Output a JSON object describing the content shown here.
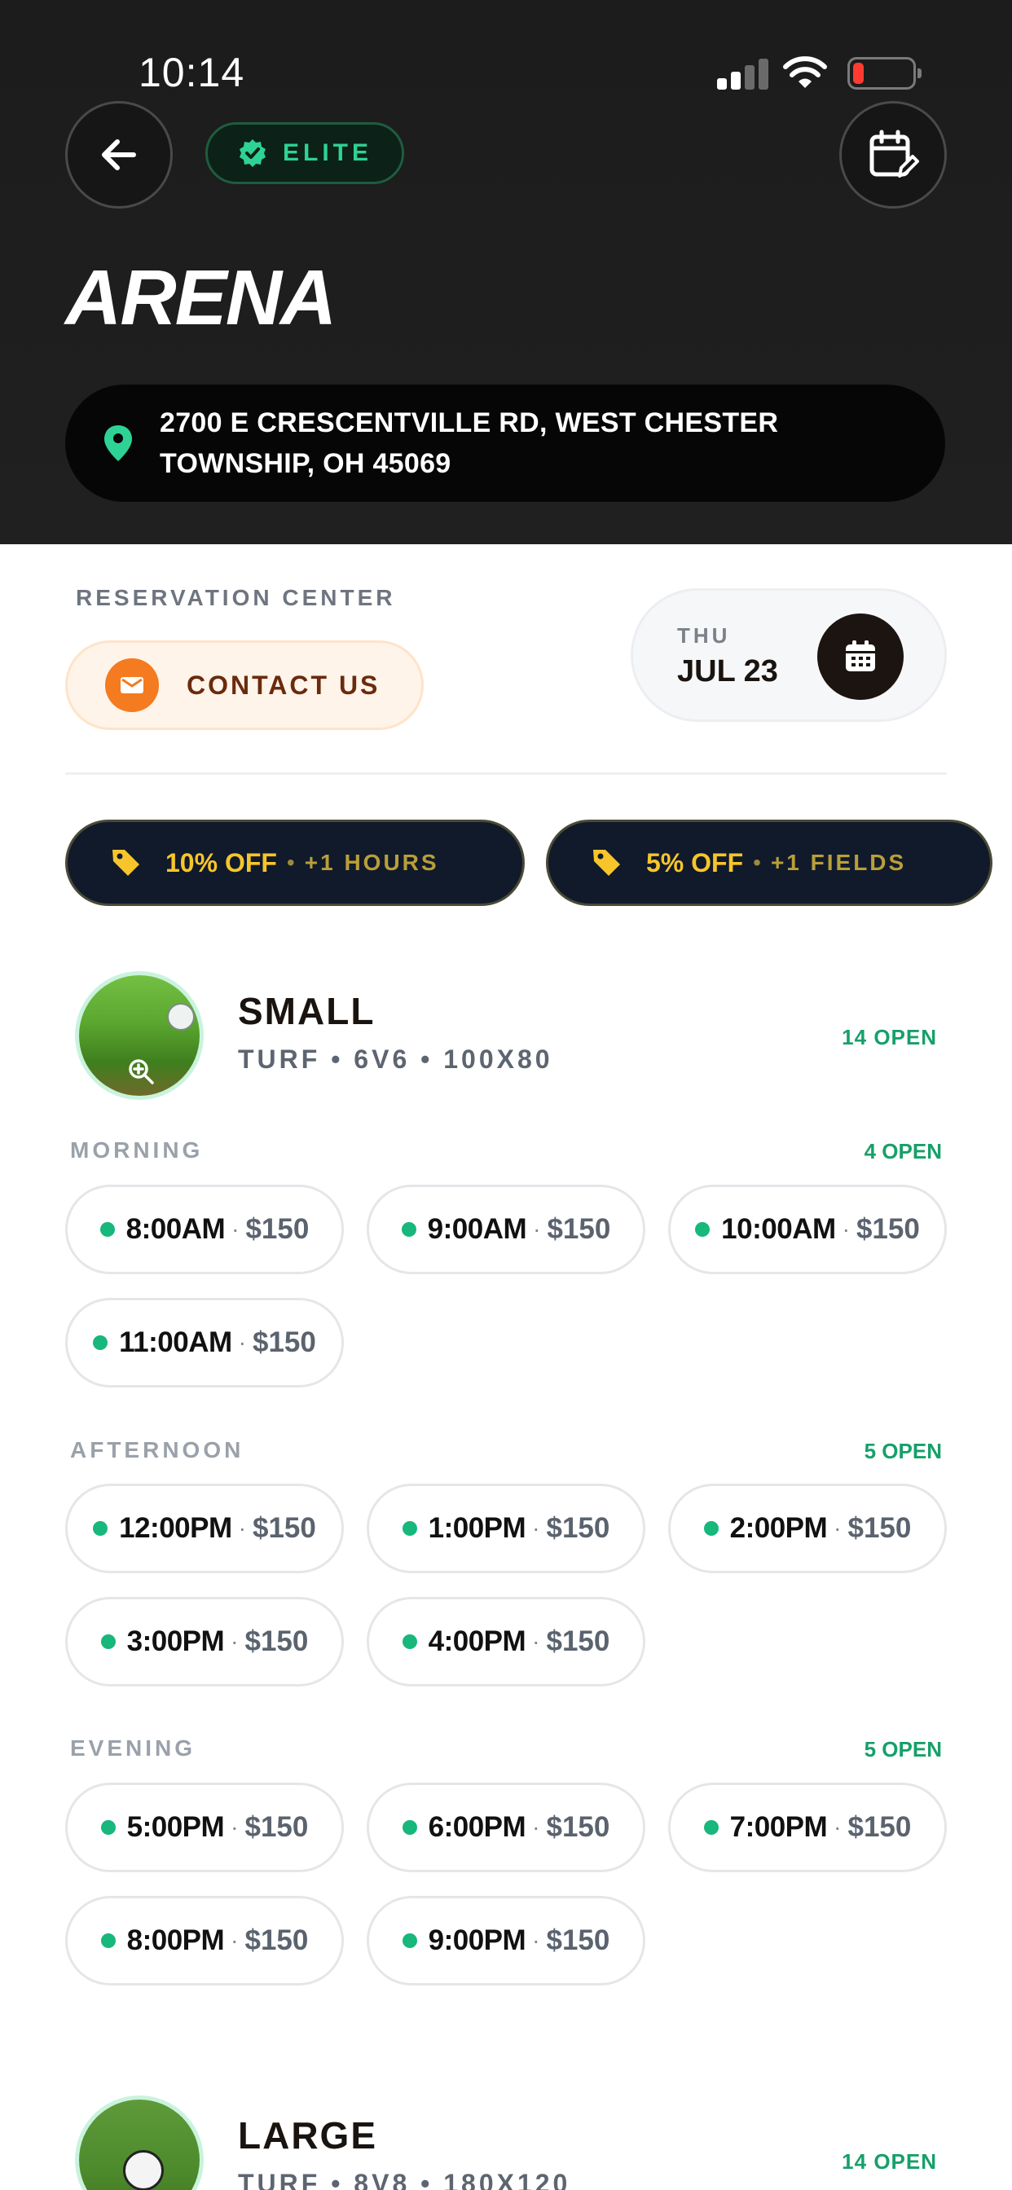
{
  "status_bar": {
    "time": "10:14"
  },
  "header": {
    "badge": "ELITE",
    "title": "ARENA",
    "address": [
      "2700 E CRESCENTVILLE RD, WEST CHESTER",
      "TOWNSHIP, OH 45069"
    ]
  },
  "reservation": {
    "label": "RESERVATION CENTER",
    "contact_label": "CONTACT US",
    "day": "THU",
    "date": "JUL 23"
  },
  "promos": [
    {
      "off": "10% OFF",
      "extra": "+1 HOURS"
    },
    {
      "off": "5% OFF",
      "extra": "+1 FIELDS"
    }
  ],
  "fields": [
    {
      "name": "SMALL",
      "specs": "TURF • 6V6 • 100X80",
      "open": "14 OPEN",
      "periods": [
        {
          "label": "MORNING",
          "open": "4 OPEN",
          "slots": [
            {
              "time": "8:00AM",
              "price": "$150"
            },
            {
              "time": "9:00AM",
              "price": "$150"
            },
            {
              "time": "10:00AM",
              "price": "$150"
            },
            {
              "time": "11:00AM",
              "price": "$150"
            }
          ]
        },
        {
          "label": "AFTERNOON",
          "open": "5 OPEN",
          "slots": [
            {
              "time": "12:00PM",
              "price": "$150"
            },
            {
              "time": "1:00PM",
              "price": "$150"
            },
            {
              "time": "2:00PM",
              "price": "$150"
            },
            {
              "time": "3:00PM",
              "price": "$150"
            },
            {
              "time": "4:00PM",
              "price": "$150"
            }
          ]
        },
        {
          "label": "EVENING",
          "open": "5 OPEN",
          "slots": [
            {
              "time": "5:00PM",
              "price": "$150"
            },
            {
              "time": "6:00PM",
              "price": "$150"
            },
            {
              "time": "7:00PM",
              "price": "$150"
            },
            {
              "time": "8:00PM",
              "price": "$150"
            },
            {
              "time": "9:00PM",
              "price": "$150"
            }
          ]
        }
      ]
    },
    {
      "name": "LARGE",
      "specs": "TURF • 8V8 • 180X120",
      "open": "14 OPEN"
    }
  ],
  "icons": {
    "back": "arrow-left-icon",
    "badge": "verified-badge-icon",
    "calendar_edit": "calendar-edit-icon",
    "location": "map-pin-icon",
    "mail": "mail-icon",
    "calendar": "calendar-icon",
    "promo": "price-tag-icon",
    "zoom": "zoom-in-icon"
  },
  "colors": {
    "header_bg": "#1c1c1c",
    "accent_green": "#18b77b",
    "promo_yellow": "#f7c52b",
    "contact_orange": "#f47b20"
  }
}
